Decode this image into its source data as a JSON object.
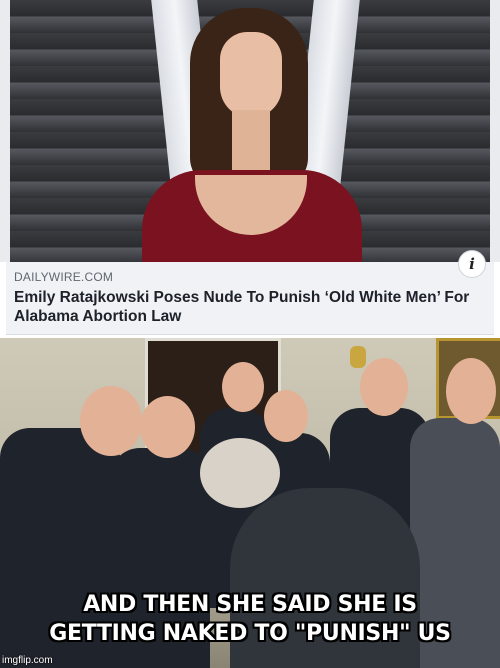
{
  "article": {
    "source": "DAILYWIRE.COM",
    "headline": "Emily Ratajkowski Poses Nude To Punish ‘Old White Men’ For Alabama Abortion Law",
    "info_icon": "info-icon"
  },
  "meme": {
    "caption_line1": "AND THEN SHE SAID SHE IS",
    "caption_line2": "GETTING NAKED TO \"PUNISH\" US",
    "watermark": "imgflip.com"
  },
  "colors": {
    "card_bg": "#f0f2f5",
    "headline": "#1d2129",
    "source": "#606770",
    "dress": "#7a1220",
    "suit": "#1f232c"
  }
}
